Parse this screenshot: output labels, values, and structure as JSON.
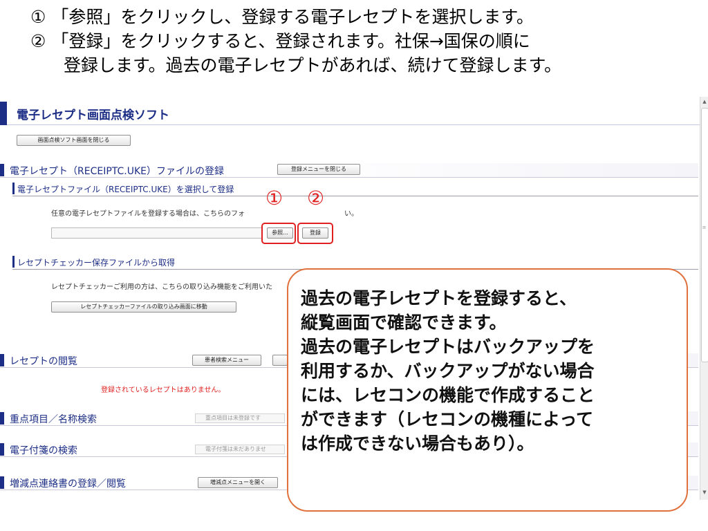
{
  "instructions": {
    "line1": "① 「参照」をクリックし、登録する電子レセプトを選択します。",
    "line2": "② 「登録」をクリックすると、登録されます。社保→国保の順に",
    "line3": "登録します。過去の電子レセプトがあれば、続けて登録します。"
  },
  "app": {
    "title": "電子レセプト画面点検ソフト",
    "close_button": "画面点検ソフト画面を閉じる",
    "register_section": {
      "title": "電子レセプト（RECEIPTC.UKE）ファイルの登録",
      "close_menu_button": "登録メニューを閉じる",
      "file_subsection": {
        "title": "電子レセプトファイル（RECEIPTC.UKE）を選択して登録",
        "desc_start": "任意の電子レセプトファイルを登録する場合は、こちらのフォ",
        "desc_end": "い。",
        "browse_button": "参照...",
        "register_button": "登録"
      },
      "checker_subsection": {
        "title": "レセプトチェッカー保存ファイルから取得",
        "desc": "レセプトチェッカーご利用の方は、こちらの取り込み機能をご利用いた",
        "move_button": "レセプトチェッカーファイルの取り込み画面に移動"
      }
    },
    "browse_section": {
      "title": "レセプトの閲覧",
      "patient_search_button": "患者検索メニュー",
      "no_receipt_message": "登録されているレセプトはありません。"
    },
    "priority_section": {
      "title": "重点項目／名称検索",
      "field_text": "重点項目は未登録です"
    },
    "tag_section": {
      "title": "電子付箋の検索",
      "field_text": "電子付箋は未だありませ"
    },
    "adjust_section": {
      "title": "増減点連絡書の登録／閲覧",
      "open_menu_button": "増減点メニューを開く"
    }
  },
  "annotations": {
    "marker1": "①",
    "marker2": "②"
  },
  "callout": {
    "lines": [
      "過去の電子レセプトを登録すると、",
      "縦覧画面で確認できます。",
      "過去の電子レセプトはバックアップを",
      "利用するか、バックアップがない場合",
      "には、レセコンの機能で作成すること",
      "ができます（レセコンの機種によって",
      "は作成できない場合もあり）。"
    ],
    "border_color": "#e0713c"
  },
  "colors": {
    "accent": "#1d2e86",
    "highlight": "#e02020"
  }
}
